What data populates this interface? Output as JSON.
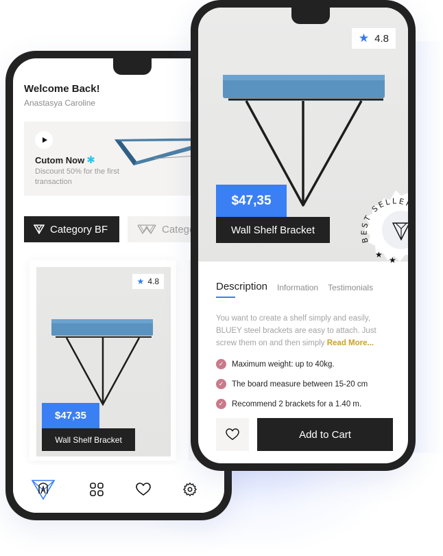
{
  "theme": {
    "accent": "#3a7ff3",
    "dark": "#222222",
    "check_color": "#c97a8a",
    "link_color": "#c9a227",
    "promo_asterisk": "#2ec4e8"
  },
  "home_screen": {
    "greeting": "Welcome Back!",
    "user_name": "Anastasya Caroline",
    "promo": {
      "title": "Cutom Now",
      "title_icon": "asterisk",
      "subtitle": "Discount 50% for the first transaction",
      "play_icon": "play-icon"
    },
    "categories": [
      {
        "label": "Category BF",
        "icon": "triangle-logo-icon",
        "active": true
      },
      {
        "label": "Catego",
        "icon": "w-logo-icon",
        "active": false
      }
    ],
    "product": {
      "rating": "4.8",
      "price": "$47,35",
      "name": "Wall Shelf Bracket"
    },
    "bottom_nav": [
      {
        "name": "home",
        "icon": "brand-logo-icon",
        "active": true
      },
      {
        "name": "categories",
        "icon": "grid-icon",
        "active": false
      },
      {
        "name": "favorites",
        "icon": "heart-icon",
        "active": false
      },
      {
        "name": "settings",
        "icon": "gear-icon",
        "active": false
      }
    ]
  },
  "detail_screen": {
    "rating": "4.8",
    "price": "$47,35",
    "name": "Wall Shelf Bracket",
    "badge_text": "BEST SELLER",
    "tabs": [
      {
        "label": "Description",
        "active": true
      },
      {
        "label": "Information",
        "active": false
      },
      {
        "label": "Testimonials",
        "active": false
      }
    ],
    "description": "You want to create a shelf simply and easily, BLUEY steel brackets are easy to attach. Just screw them on and then simply",
    "read_more": "Read More...",
    "features": [
      "Maximum weight: up to 40kg.",
      "The board measure between 15-20 cm",
      "Recommend 2 brackets for a 1.40 m."
    ],
    "add_to_cart": "Add to Cart"
  }
}
